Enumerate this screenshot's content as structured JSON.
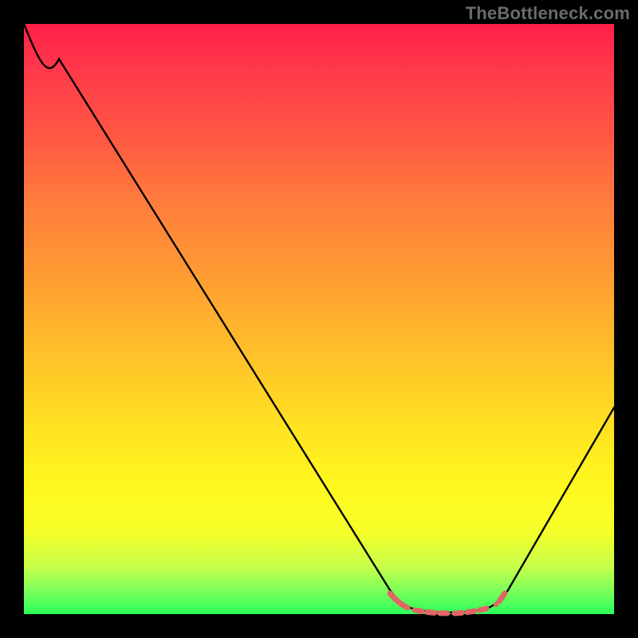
{
  "watermark": "TheBottleneck.com",
  "colors": {
    "page_bg": "#000000",
    "gradient_top": "#ff1f4a",
    "gradient_mid1": "#ff9a33",
    "gradient_mid2": "#ffe122",
    "gradient_bottom": "#2bff5a",
    "curve": "#000000",
    "marker": "#e06666"
  },
  "chart_data": {
    "type": "line",
    "title": "",
    "xlabel": "",
    "ylabel": "",
    "xlim": [
      0,
      100
    ],
    "ylim": [
      0,
      100
    ],
    "grid": false,
    "series": [
      {
        "name": "curve",
        "x": [
          0,
          3,
          6,
          62,
          64,
          66,
          70,
          74,
          78,
          80,
          82,
          100
        ],
        "y": [
          100,
          97,
          94,
          4,
          1.5,
          0.6,
          0.2,
          0.2,
          0.6,
          1.5,
          4,
          35
        ]
      }
    ],
    "markers": {
      "name": "highlight-band",
      "x_range": [
        62,
        80
      ],
      "style": "dotted-red"
    },
    "annotations": []
  }
}
